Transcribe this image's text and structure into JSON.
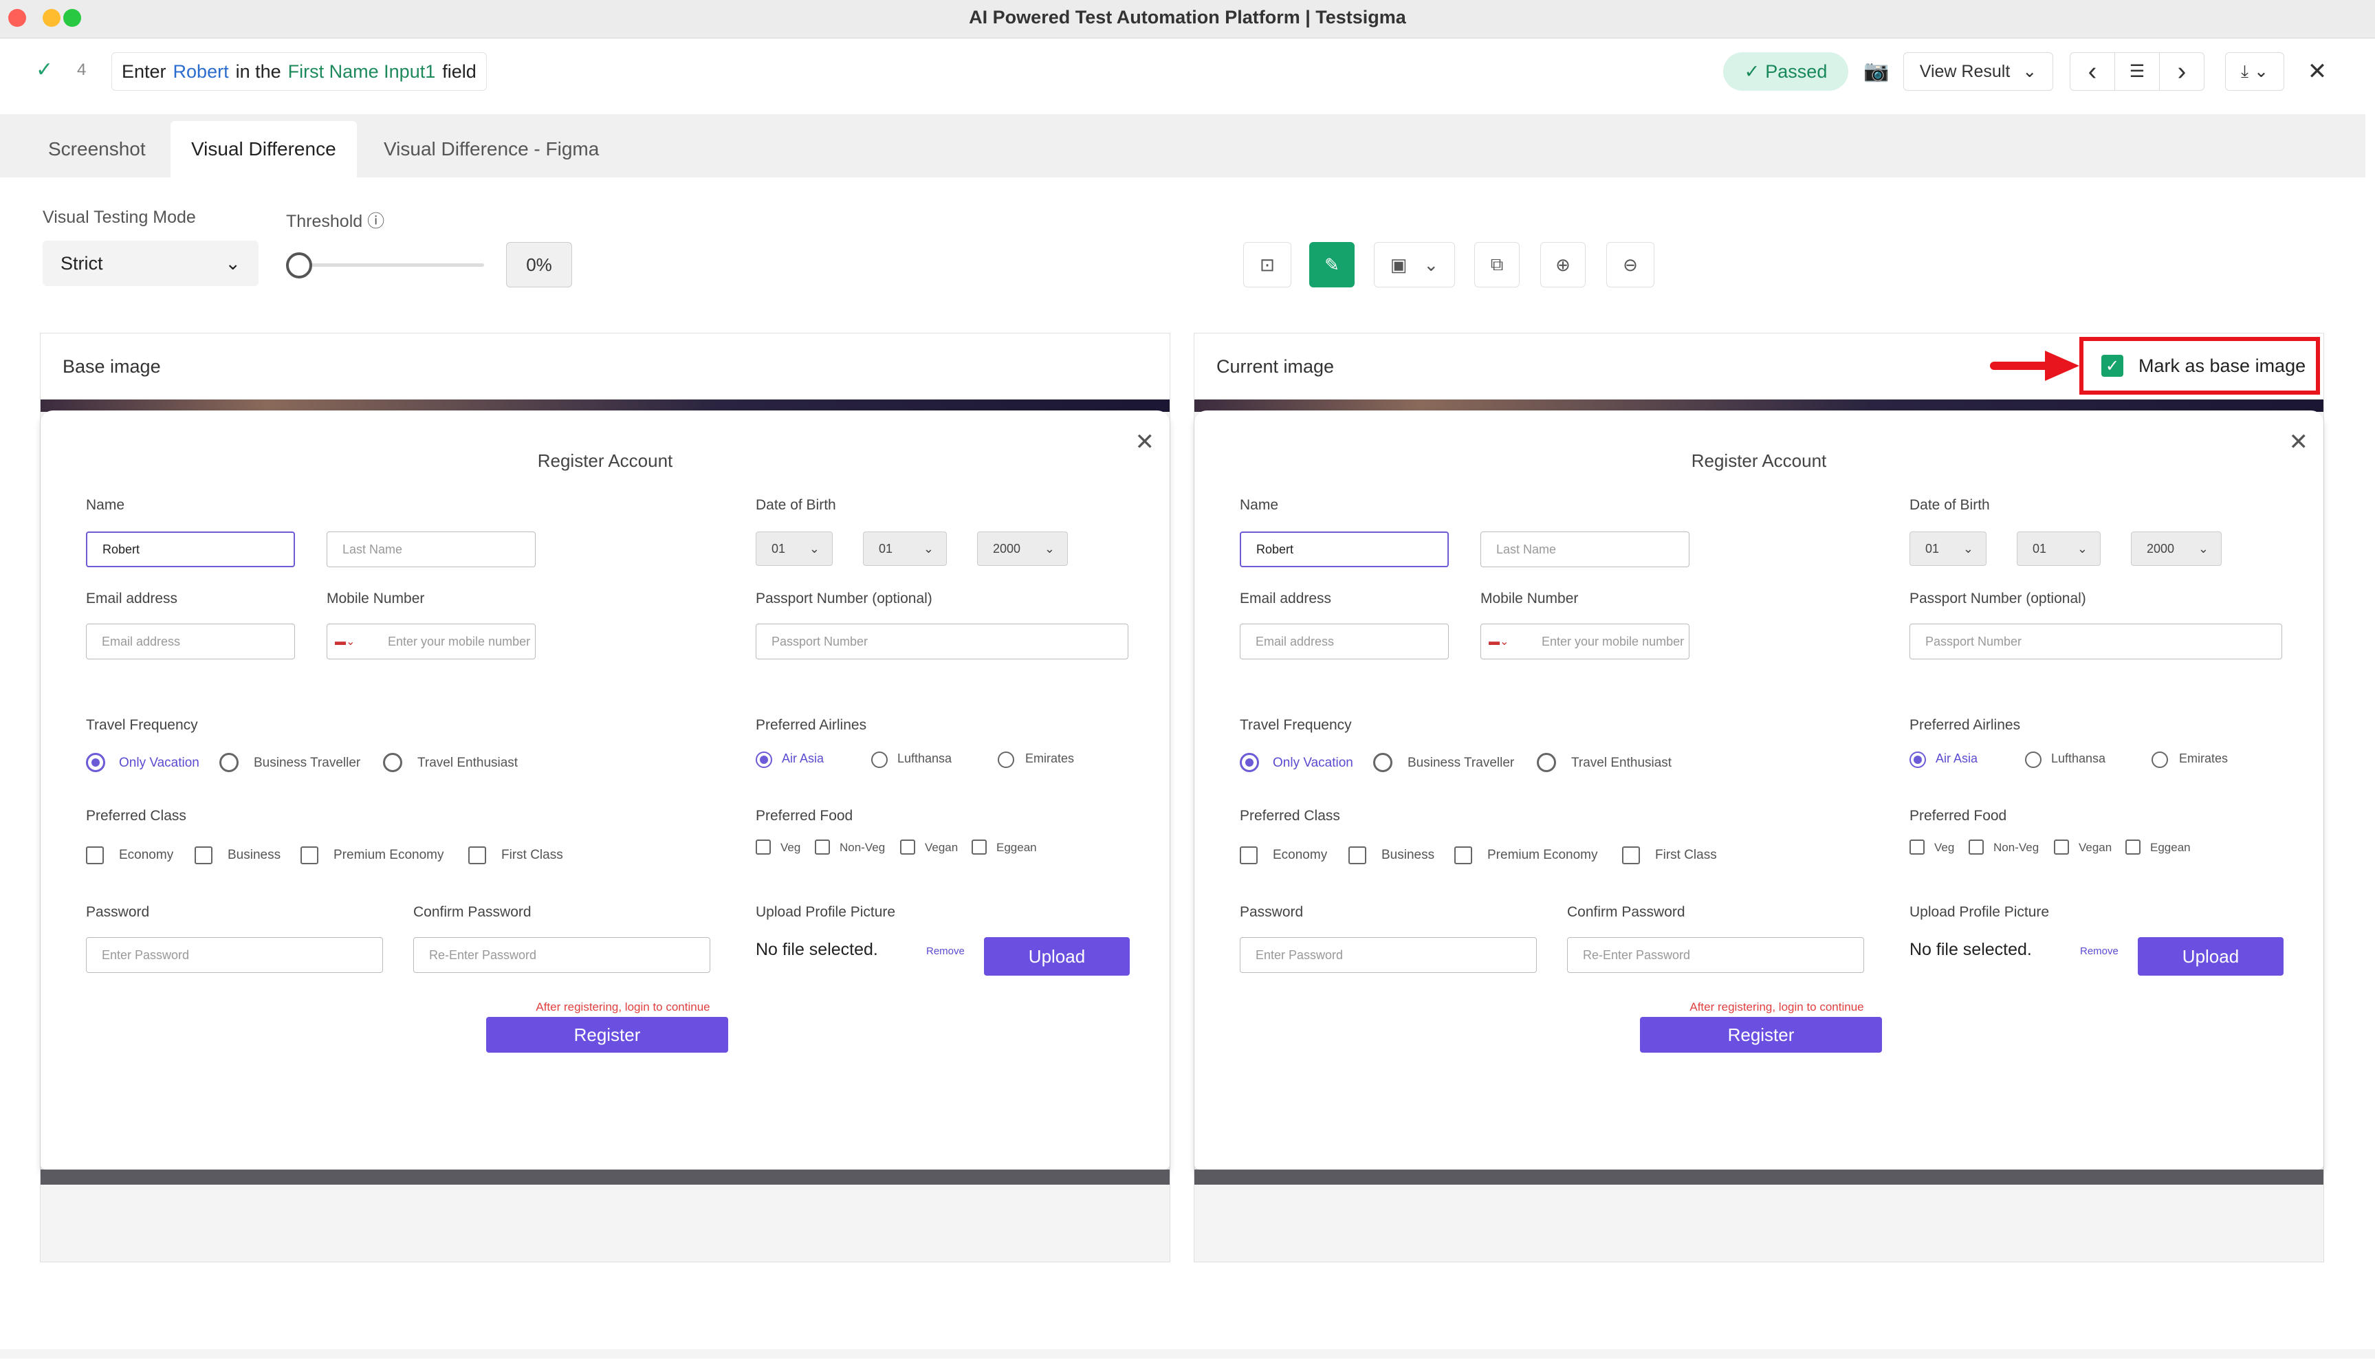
{
  "window": {
    "title": "AI Powered Test Automation Platform | Testsigma"
  },
  "step": {
    "number": "4",
    "parts": [
      "Enter",
      "Robert",
      "in the",
      "First Name Input1",
      "field"
    ],
    "status": "Passed",
    "view_result": "View Result"
  },
  "tabs": [
    "Screenshot",
    "Visual Difference",
    "Visual Difference - Figma"
  ],
  "active_tab": "Visual Difference",
  "controls": {
    "mode_label": "Visual Testing Mode",
    "mode_value": "Strict",
    "threshold_label": "Threshold",
    "threshold_value": "0%",
    "threshold_level": 0
  },
  "panels": {
    "base_title": "Base image",
    "current_title": "Current image",
    "mark_as_base": "Mark as base image",
    "mark_as_base_checked": true
  },
  "form": {
    "title": "Register Account",
    "name_label": "Name",
    "first_name_value": "Robert",
    "last_name_placeholder": "Last Name",
    "dob_label": "Date of Birth",
    "dob_day": "01",
    "dob_month": "01",
    "dob_year": "2000",
    "email_label": "Email address",
    "email_placeholder": "Email address",
    "mobile_label": "Mobile Number",
    "mobile_placeholder": "Enter your mobile number",
    "passport_label": "Passport Number (optional)",
    "passport_placeholder": "Passport Number",
    "travel_label": "Travel Frequency",
    "travel_options": [
      "Only Vacation",
      "Business Traveller",
      "Travel Enthusiast"
    ],
    "airlines_label": "Preferred Airlines",
    "airline_options": [
      "Air Asia",
      "Lufthansa",
      "Emirates"
    ],
    "class_label": "Preferred Class",
    "class_options": [
      "Economy",
      "Business",
      "Premium Economy",
      "First Class"
    ],
    "food_label": "Preferred Food",
    "food_options": [
      "Veg",
      "Non-Veg",
      "Vegan",
      "Eggean"
    ],
    "password_label": "Password",
    "password_placeholder": "Enter Password",
    "confirm_label": "Confirm Password",
    "confirm_placeholder": "Re-Enter Password",
    "upload_label": "Upload Profile Picture",
    "no_file": "No file selected.",
    "remove": "Remove",
    "upload_btn": "Upload",
    "note": "After registering, login to continue",
    "register_btn": "Register"
  },
  "icons": {
    "check": "✓",
    "camera": "📷",
    "chevron": "⌄",
    "prev": "‹",
    "next": "›",
    "list": "☰",
    "download": "⤓",
    "close": "✕",
    "info": "ⓘ",
    "tool1": "⊡",
    "tool2": "✎",
    "tool3": "▣",
    "tool4": "⧉",
    "zoom_in": "⊕",
    "zoom_out": "⊖"
  },
  "colors": {
    "accent_green": "#16a36b",
    "accent_purple": "#6b4fe0",
    "highlight_red": "#e8141e"
  }
}
